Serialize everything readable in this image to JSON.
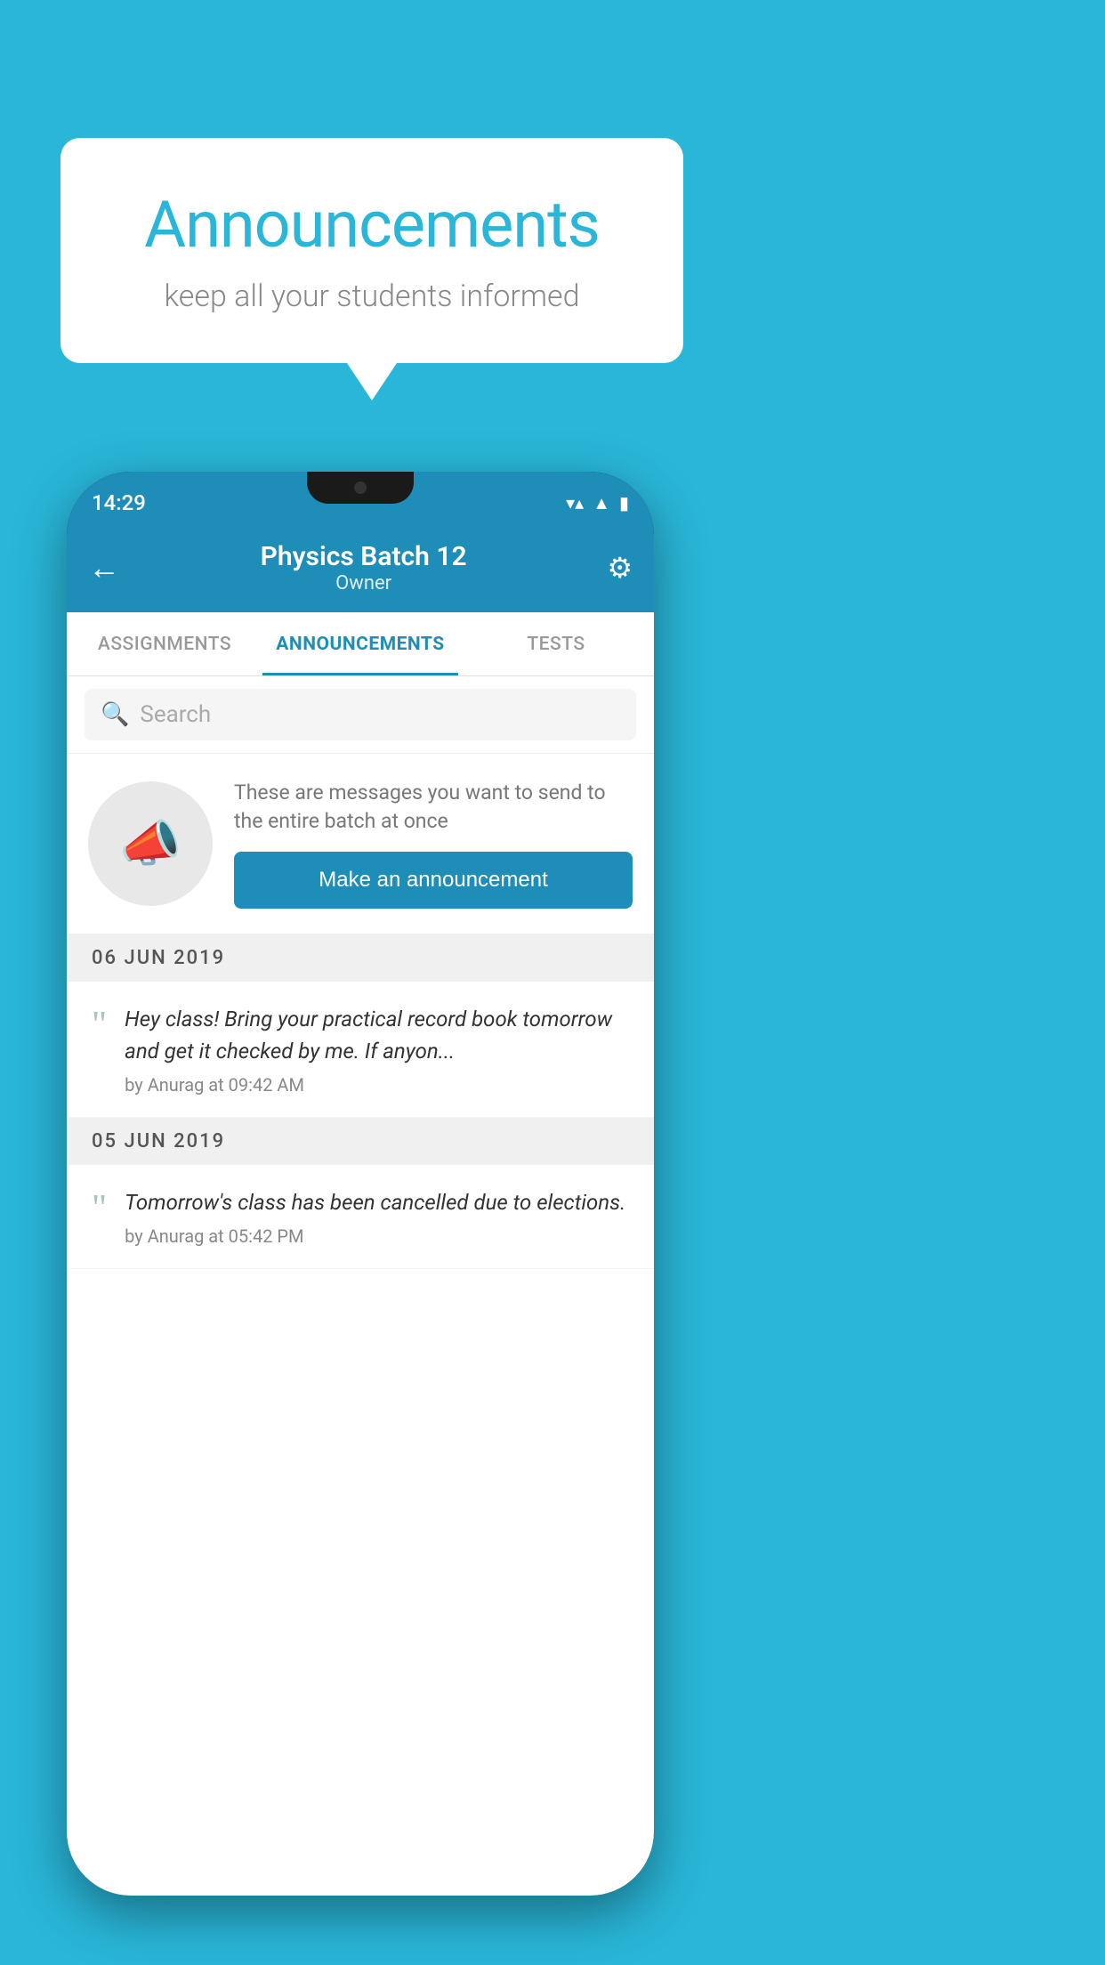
{
  "background_color": "#29b6d8",
  "speech_bubble": {
    "title": "Announcements",
    "subtitle": "keep all your students informed"
  },
  "phone": {
    "status_bar": {
      "time": "14:29",
      "icons": [
        "wifi",
        "signal",
        "battery"
      ]
    },
    "header": {
      "title": "Physics Batch 12",
      "subtitle": "Owner",
      "back_label": "←",
      "settings_label": "⚙"
    },
    "tabs": [
      {
        "label": "ASSIGNMENTS",
        "active": false
      },
      {
        "label": "ANNOUNCEMENTS",
        "active": true
      },
      {
        "label": "TESTS",
        "active": false
      }
    ],
    "search": {
      "placeholder": "Search"
    },
    "promo": {
      "description": "These are messages you want to send to the entire batch at once",
      "button_label": "Make an announcement"
    },
    "announcements": [
      {
        "date": "06  JUN  2019",
        "messages": [
          {
            "text": "Hey class! Bring your practical record book tomorrow and get it checked by me. If anyon...",
            "meta": "by Anurag at 09:42 AM"
          }
        ]
      },
      {
        "date": "05  JUN  2019",
        "messages": [
          {
            "text": "Tomorrow's class has been cancelled due to elections.",
            "meta": "by Anurag at 05:42 PM"
          }
        ]
      }
    ]
  }
}
